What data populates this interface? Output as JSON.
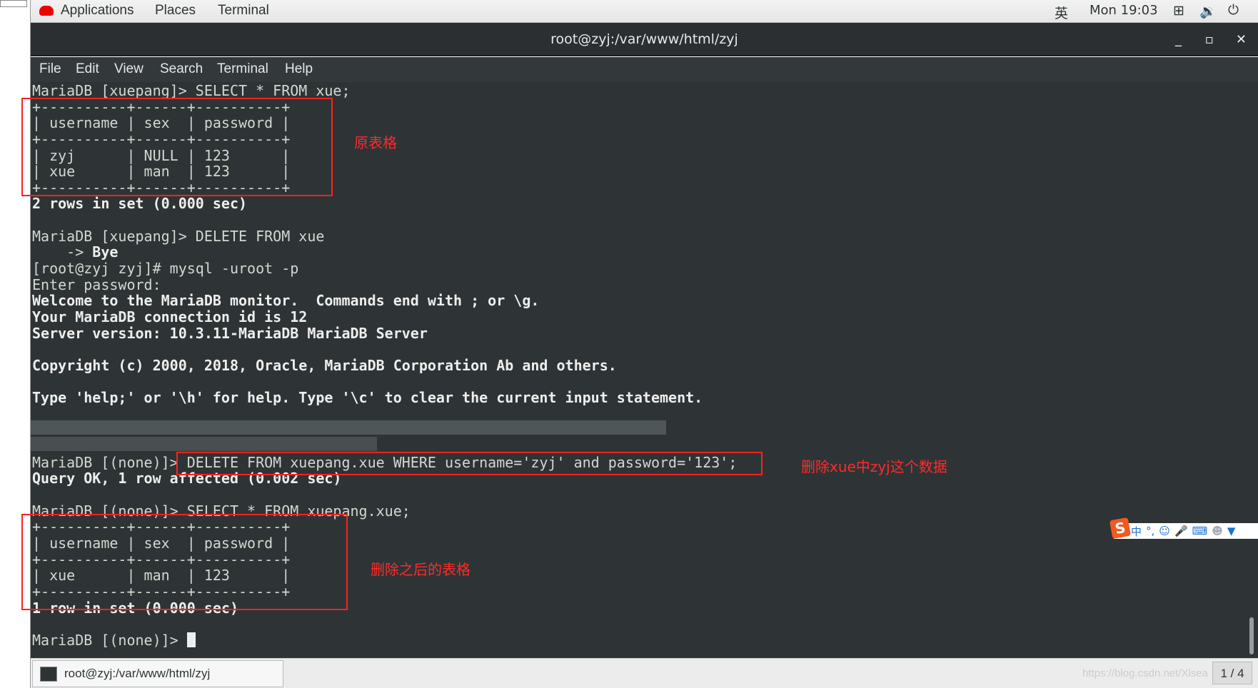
{
  "topbar": {
    "applications": "Applications",
    "places": "Places",
    "terminal": "Terminal",
    "input_method": "英",
    "clock": "Mon 19:03"
  },
  "window": {
    "title": "root@zyj:/var/www/html/zyj",
    "minimize": "_",
    "maximize": "▫",
    "close": "✕"
  },
  "menu": [
    "File",
    "Edit",
    "View",
    "Search",
    "Terminal",
    "Help"
  ],
  "terminal_lines": [
    [
      {
        "t": "MariaDB [xuepang]> SELECT * FROM xue;"
      }
    ],
    [
      {
        "t": "+----------+------+----------+"
      }
    ],
    [
      {
        "t": "| username | sex  | password |"
      }
    ],
    [
      {
        "t": "+----------+------+----------+"
      }
    ],
    [
      {
        "t": "| zyj      | NULL | 123      |"
      }
    ],
    [
      {
        "t": "| xue      | man  | 123      |"
      }
    ],
    [
      {
        "t": "+----------+------+----------+"
      }
    ],
    [
      {
        "t": "2 rows in set (0.000 sec)",
        "b": true
      }
    ],
    [
      {
        "t": ""
      }
    ],
    [
      {
        "t": "MariaDB [xuepang]> DELETE FROM xue"
      }
    ],
    [
      {
        "t": "    -> "
      },
      {
        "t": "Bye",
        "b": true
      }
    ],
    [
      {
        "t": "[root@zyj zyj]# mysql -uroot -p"
      }
    ],
    [
      {
        "t": "Enter password:"
      }
    ],
    [
      {
        "t": "Welcome to the MariaDB monitor.  Commands end with ; or \\g.",
        "b": true
      }
    ],
    [
      {
        "t": "Your MariaDB connection id is 12",
        "b": true
      }
    ],
    [
      {
        "t": "Server version: 10.3.11-MariaDB MariaDB Server",
        "b": true
      }
    ],
    [
      {
        "t": ""
      }
    ],
    [
      {
        "t": "Copyright (c) 2000, 2018, Oracle, MariaDB Corporation Ab and others.",
        "b": true
      }
    ],
    [
      {
        "t": ""
      }
    ],
    [
      {
        "t": "Type 'help;' or '\\h' for help. Type '\\c' to clear the current input statement.",
        "b": true
      }
    ],
    [
      {
        "t": ""
      }
    ],
    [
      {
        "t": ""
      }
    ],
    [
      {
        "t": ""
      }
    ],
    [
      {
        "t": "MariaDB [(none)]> DELETE FROM xuepang.xue WHERE username='zyj' and password='123';"
      }
    ],
    [
      {
        "t": "Query OK, 1 row affected (0.002 sec)",
        "b": true
      }
    ],
    [
      {
        "t": ""
      }
    ],
    [
      {
        "t": "MariaDB [(none)]> SELECT * FROM xuepang.xue;"
      }
    ],
    [
      {
        "t": "+----------+------+----------+"
      }
    ],
    [
      {
        "t": "| username | sex  | password |"
      }
    ],
    [
      {
        "t": "+----------+------+----------+"
      }
    ],
    [
      {
        "t": "| xue      | man  | 123      |"
      }
    ],
    [
      {
        "t": "+----------+------+----------+"
      }
    ],
    [
      {
        "t": "1 row in set (0.000 sec)",
        "b": true
      }
    ],
    [
      {
        "t": ""
      }
    ],
    [
      {
        "t": "MariaDB [(none)]> "
      }
    ]
  ],
  "annotations": {
    "original_table": "原表格",
    "delete_note": "删除xue中zyj这个数据",
    "after_table": "删除之后的表格"
  },
  "ime": {
    "logo": "S",
    "mode": "中",
    "punct": "°,"
  },
  "taskbar": {
    "task": "root@zyj:/var/www/html/zyj",
    "watermark": "https://blog.csdn.net/Xlsea",
    "pager": "1 / 4"
  },
  "colors": {
    "terminal_bg": "#2e3436",
    "annotation": "#ff2020"
  }
}
